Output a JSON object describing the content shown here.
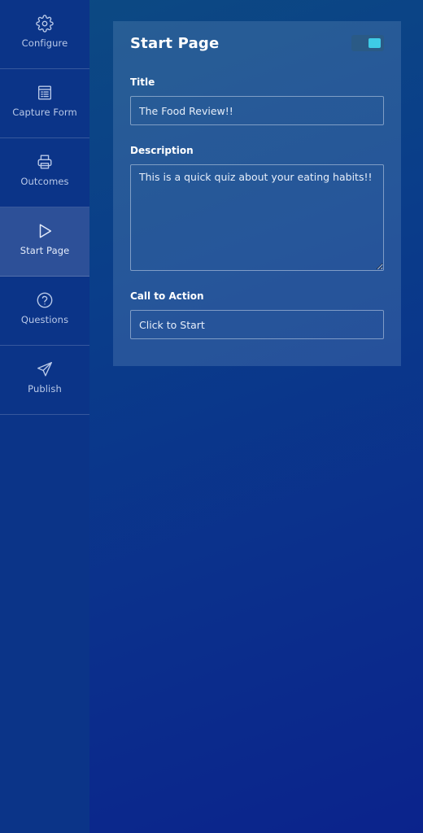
{
  "sidebar": {
    "items": [
      {
        "label": "Configure",
        "icon": "gear-icon",
        "active": false
      },
      {
        "label": "Capture Form",
        "icon": "form-icon",
        "active": false
      },
      {
        "label": "Outcomes",
        "icon": "printer-icon",
        "active": false
      },
      {
        "label": "Start Page",
        "icon": "play-icon",
        "active": true
      },
      {
        "label": "Questions",
        "icon": "question-circle-icon",
        "active": false
      },
      {
        "label": "Publish",
        "icon": "paper-plane-icon",
        "active": false
      }
    ]
  },
  "panel": {
    "title": "Start Page",
    "toggle_on": true,
    "fields": {
      "title": {
        "label": "Title",
        "value": "The Food Review!!"
      },
      "description": {
        "label": "Description",
        "value": "This is a quick quiz about your eating habits!!"
      },
      "cta": {
        "label": "Call to Action",
        "value": "Click to Start"
      }
    }
  },
  "colors": {
    "sidebar_bg": "#0b3488",
    "accent": "#3ecbe6"
  }
}
